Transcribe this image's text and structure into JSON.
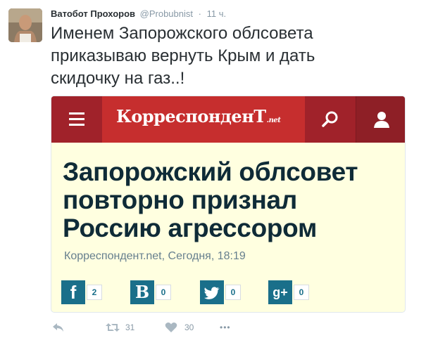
{
  "tweet": {
    "author_name": "Ватобот Прохоров",
    "handle": "@Probubnist",
    "separator": "·",
    "time": "11 ч.",
    "text": "Именем Запорожского облсовета приказываю вернуть Крым и дать скидочку на газ..!"
  },
  "card": {
    "logo_text": "КорреспонденТ",
    "logo_suffix": ".net",
    "headline": "Запорожский облсовет повторно признал Россию агрессором",
    "source": "Корреспондент.net, Сегодня, 18:19",
    "shares": [
      {
        "glyph": "f",
        "count": "2",
        "icon": "facebook-icon"
      },
      {
        "glyph": "В",
        "count": "0",
        "icon": "vkontakte-icon"
      },
      {
        "glyph": "",
        "count": "0",
        "icon": "twitter-icon"
      },
      {
        "glyph": "g+",
        "count": "0",
        "icon": "google-plus-icon"
      }
    ],
    "colors": {
      "header": "#c62e2e",
      "header_dark": "#a0222a",
      "background": "#ffffe0",
      "share": "#1a6f8a",
      "headline": "#0f2b37"
    }
  },
  "actions": {
    "retweets": "31",
    "likes": "30",
    "more": "•••"
  }
}
